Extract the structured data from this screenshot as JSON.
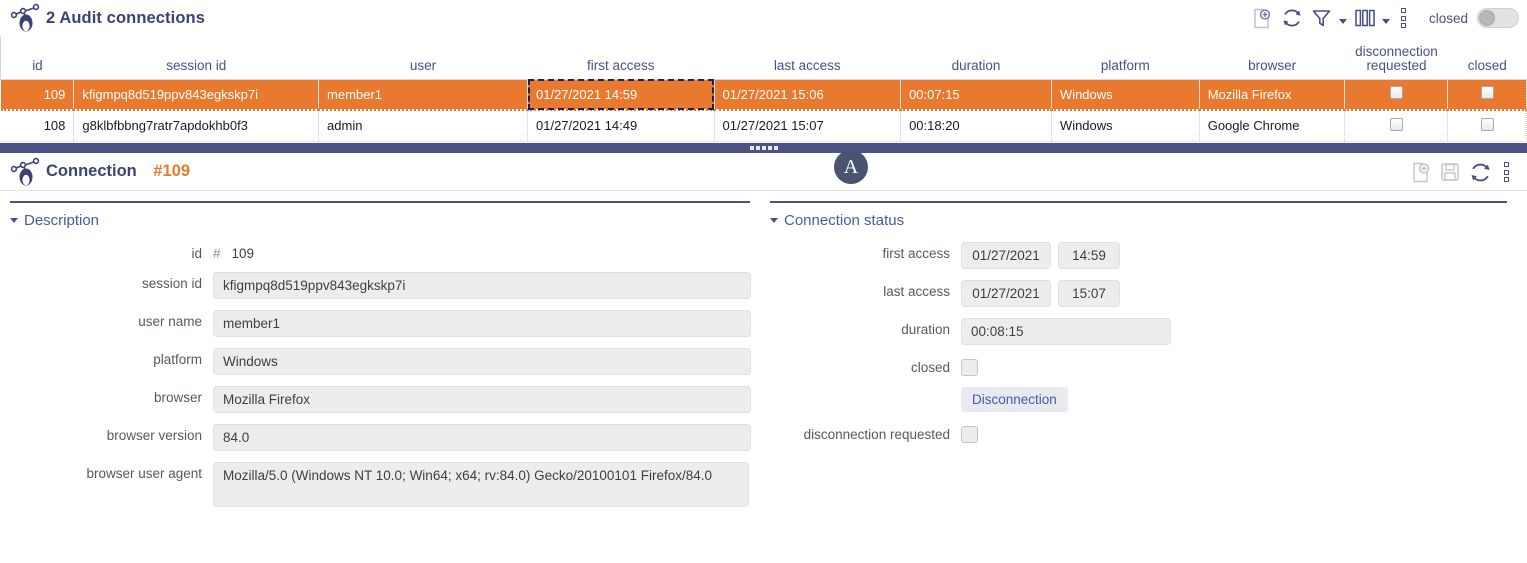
{
  "list_panel": {
    "title": "2 Audit connections",
    "logo_icon": "audit-connections-logo",
    "toolbar": {
      "add_icon": "add-page-icon",
      "refresh_icon": "refresh-icon",
      "filter_icon": "filter-icon",
      "filter_caret_icon": "chevron-down-icon",
      "columns_icon": "columns-icon",
      "columns_caret_icon": "chevron-down-icon",
      "more_icon": "more-options-icon",
      "closed_label": "closed",
      "closed_toggle_state": "off"
    },
    "columns": [
      "id",
      "session id",
      "user",
      "first access",
      "last access",
      "duration",
      "platform",
      "browser",
      "disconnection requested",
      "closed"
    ],
    "rows": [
      {
        "id": "109",
        "session_id": "kfigmpq8d519ppv843egkskp7i",
        "user": "member1",
        "first_access": "01/27/2021 14:59",
        "last_access": "01/27/2021 15:06",
        "duration": "00:07:15",
        "platform": "Windows",
        "browser": "Mozilla Firefox",
        "disconnection_requested": false,
        "closed": false,
        "selected": true,
        "focused_cell": "first_access"
      },
      {
        "id": "108",
        "session_id": "g8klbfbbng7ratr7apdokhb0f3",
        "user": "admin",
        "first_access": "01/27/2021 14:49",
        "last_access": "01/27/2021 15:07",
        "duration": "00:18:20",
        "platform": "Windows",
        "browser": "Google Chrome",
        "disconnection_requested": false,
        "closed": false,
        "selected": false,
        "focused_cell": ""
      }
    ]
  },
  "splitter": {
    "grip_icon": "splitter-grip"
  },
  "detail_panel": {
    "logo_icon": "audit-connections-logo",
    "title": "Connection",
    "record_hash": "#109",
    "avatar_letter": "A",
    "toolbar": {
      "add_icon": "add-page-icon",
      "save_icon": "save-icon",
      "refresh_icon": "refresh-icon",
      "more_icon": "more-options-icon"
    },
    "description": {
      "section_title": "Description",
      "fields": {
        "id_label": "id",
        "id_symbol": "#",
        "id_value": "109",
        "session_id_label": "session id",
        "session_id_value": "kfigmpq8d519ppv843egkskp7i",
        "user_name_label": "user name",
        "user_name_value": "member1",
        "platform_label": "platform",
        "platform_value": "Windows",
        "browser_label": "browser",
        "browser_value": "Mozilla Firefox",
        "browser_version_label": "browser version",
        "browser_version_value": "84.0",
        "browser_user_agent_label": "browser user agent",
        "browser_user_agent_value": "Mozilla/5.0 (Windows NT 10.0; Win64; x64; rv:84.0) Gecko/20100101 Firefox/84.0"
      }
    },
    "connection_status": {
      "section_title": "Connection status",
      "fields": {
        "first_access_label": "first access",
        "first_access_date": "01/27/2021",
        "first_access_time": "14:59",
        "last_access_label": "last access",
        "last_access_date": "01/27/2021",
        "last_access_time": "15:07",
        "duration_label": "duration",
        "duration_value": "00:08:15",
        "closed_label": "closed",
        "closed_checked": false,
        "disconnection_button_label": "Disconnection",
        "disconnection_requested_label": "disconnection requested",
        "disconnection_requested_checked": false
      }
    }
  },
  "colors": {
    "accent_orange": "#e8792e",
    "brand_navy": "#3d4275",
    "splitter": "#4d5285",
    "link_blue": "#4a5aa0"
  }
}
